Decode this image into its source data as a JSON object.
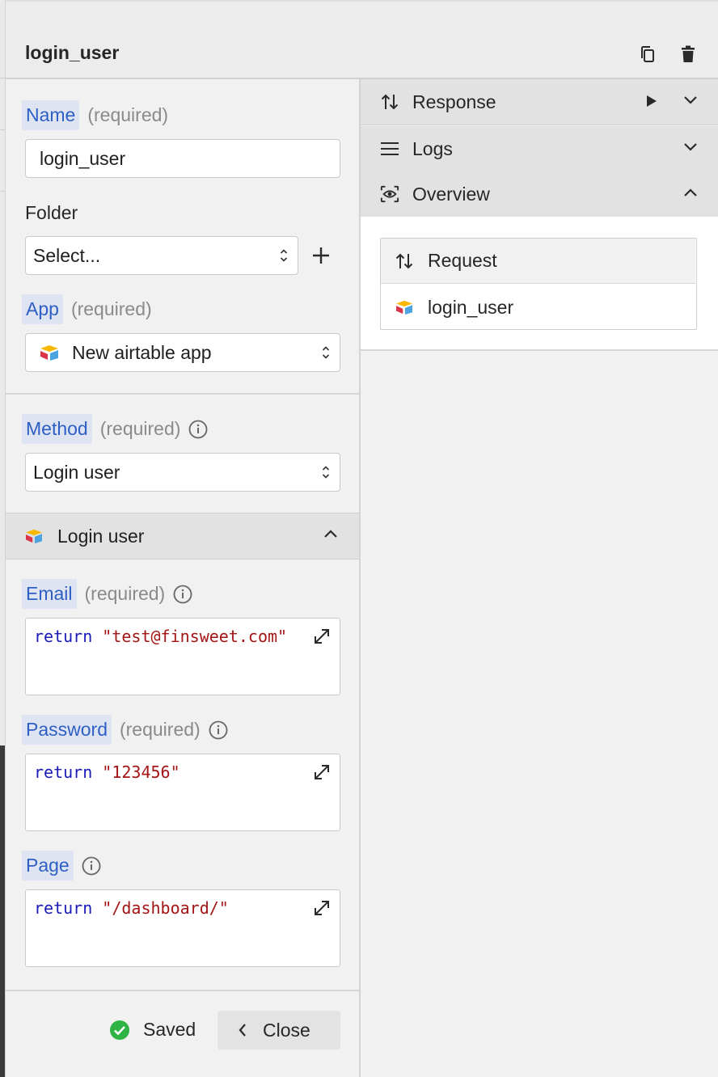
{
  "header": {
    "title": "login_user"
  },
  "form": {
    "name": {
      "label": "Name",
      "required": "(required)",
      "value": "login_user"
    },
    "folder": {
      "label": "Folder",
      "value": "Select..."
    },
    "app": {
      "label": "App",
      "required": "(required)",
      "value": "New airtable app",
      "icon": "airtable-logo-icon"
    },
    "method": {
      "label": "Method",
      "required": "(required)",
      "value": "Login user"
    }
  },
  "section": {
    "title": "Login user",
    "fields": [
      {
        "label": "Email",
        "required": "(required)",
        "code_keyword": "return",
        "code_value": "\"test@finsweet.com\""
      },
      {
        "label": "Password",
        "required": "(required)",
        "code_keyword": "return",
        "code_value": "\"123456\""
      },
      {
        "label": "Page",
        "code_keyword": "return",
        "code_value": "\"/dashboard/\""
      }
    ]
  },
  "footer": {
    "status": "Saved",
    "close_label": "Close"
  },
  "right": {
    "accordions": [
      {
        "label": "Response",
        "icon": "arrows-up-down-icon"
      },
      {
        "label": "Logs",
        "icon": "list-lines-icon"
      },
      {
        "label": "Overview",
        "icon": "eye-box-icon"
      }
    ],
    "overview": {
      "header": "Request",
      "item": "login_user"
    }
  },
  "colors": {
    "label_chip_bg": "#dfe4f2",
    "label_text": "#2d5fc4",
    "code_keyword": "#1a1ab8",
    "code_string": "#a31515",
    "saved_green": "#2fb344"
  }
}
